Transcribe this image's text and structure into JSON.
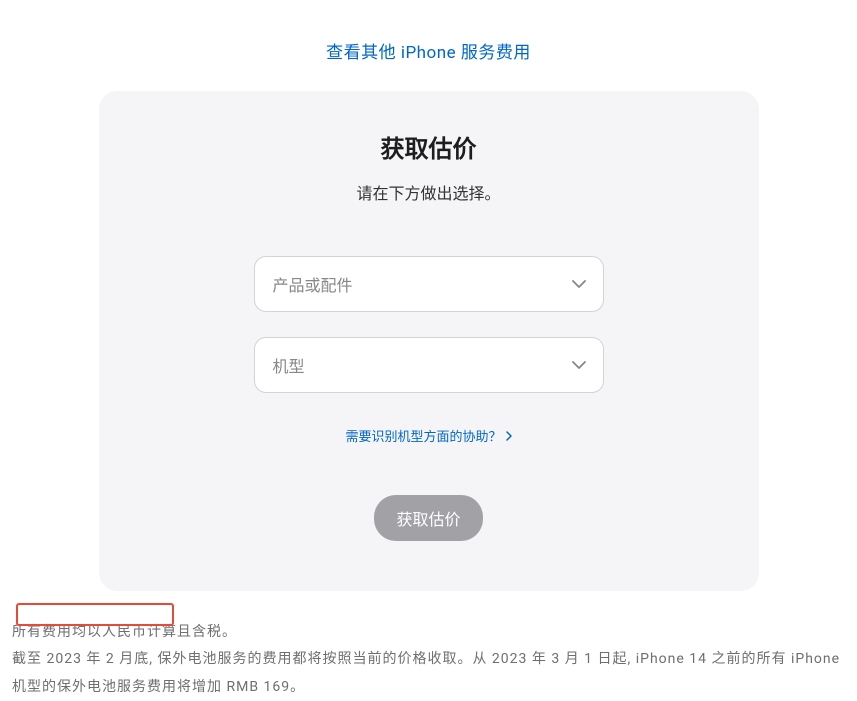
{
  "topLink": {
    "label": "查看其他 iPhone 服务费用"
  },
  "card": {
    "title": "获取估价",
    "subtitle": "请在下方做出选择。",
    "productSelect": {
      "placeholder": "产品或配件"
    },
    "modelSelect": {
      "placeholder": "机型"
    },
    "helpLink": "需要识别机型方面的协助？",
    "submitLabel": "获取估价"
  },
  "footer": {
    "line1": "所有费用均以人民币计算且含税。",
    "line2": "截至 2023 年 2 月底, 保外电池服务的费用都将按照当前的价格收取。从 2023 年 3 月 1 日起, iPhone 14 之前的所有 iPhone 机型的保外电池服务费用将增加 RMB 169。"
  }
}
